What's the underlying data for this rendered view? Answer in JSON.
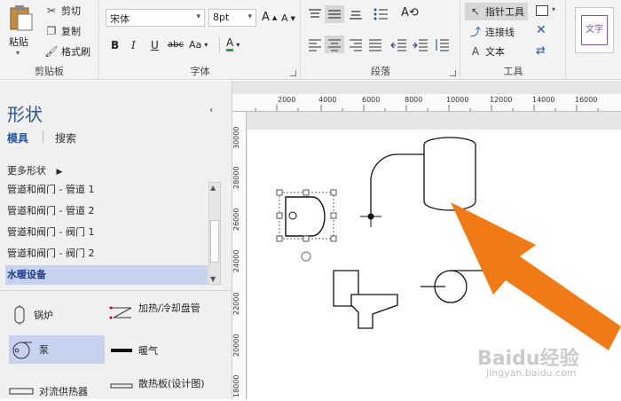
{
  "ribbon": {
    "clipboard": {
      "label": "剪贴板",
      "paste": "粘贴",
      "cut": "剪切",
      "copy": "复制",
      "format_painter": "格式刷"
    },
    "font": {
      "label": "字体",
      "family": "宋体",
      "size": "8pt",
      "bold": "B",
      "italic": "I",
      "underline": "U",
      "strike": "abc",
      "case": "Aa",
      "color_letter": "A",
      "grow": "A",
      "shrink": "A"
    },
    "paragraph": {
      "label": "段落"
    },
    "tools": {
      "label": "工具",
      "pointer": "指针工具",
      "connector": "连接线",
      "text": "文本",
      "text_letter": "A"
    },
    "style_preview": "文字"
  },
  "ruler": {
    "h_ticks": [
      "2000",
      "4000",
      "6000",
      "8000",
      "10000",
      "12000",
      "14000",
      "16000"
    ],
    "v_ticks": [
      "30000",
      "28000",
      "26000",
      "24000",
      "22000",
      "20000",
      "18000"
    ]
  },
  "shapes_panel": {
    "title": "形状",
    "tab_stencils": "模具",
    "tab_search": "搜索",
    "more_shapes": "更多形状",
    "list": [
      "管道和阀门 - 管道 1",
      "管道和阀门 - 管道 2",
      "管道和阀门 - 阀门 1",
      "管道和阀门 - 阀门 2",
      "水暖设备"
    ],
    "stencils": [
      {
        "label": "锅炉"
      },
      {
        "label": "加热/冷却盘管"
      },
      {
        "label": "泵"
      },
      {
        "label": "暖气"
      },
      {
        "label": "对流供热器"
      },
      {
        "label": "散热板(设计图)"
      }
    ]
  },
  "colors": {
    "accent_blue": "#2b579a",
    "selected_row": "#c6d2ee",
    "arrow_orange": "#f07a16"
  },
  "watermark": {
    "brand": "Baidu经验",
    "url": "jingyan.baidu.com"
  }
}
